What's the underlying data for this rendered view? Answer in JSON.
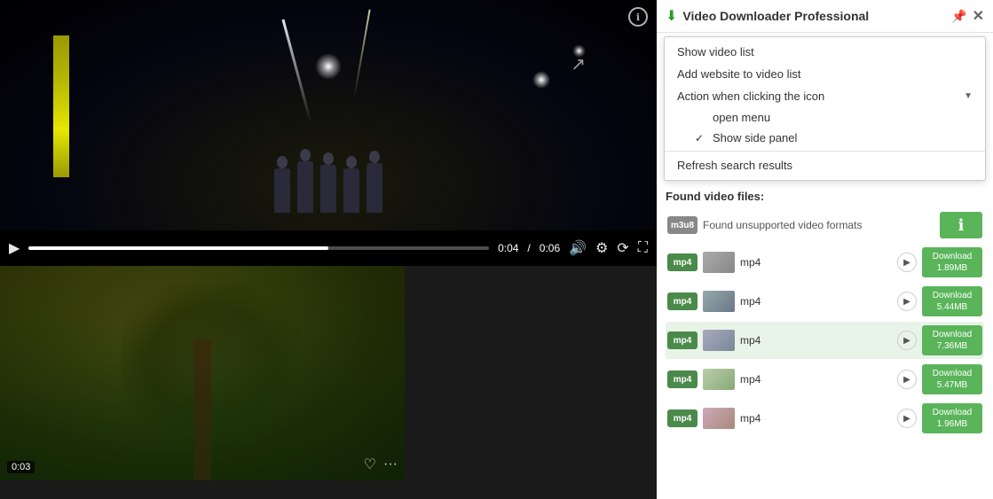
{
  "panel": {
    "title": "Video Downloader Professional",
    "pin_label": "📌",
    "close_label": "✕"
  },
  "menu": {
    "show_video_list": "Show video list",
    "add_website": "Add website to video list",
    "action_label": "Action when clicking the icon",
    "open_menu": "open menu",
    "show_side_panel": "Show side panel",
    "refresh": "Refresh search results"
  },
  "found_section": {
    "header": "Found video files:"
  },
  "video_rows": [
    {
      "format": "m3u8",
      "badge_class": "badge-m3u8",
      "label": "Found unsupported video formats",
      "type": "unsupported"
    },
    {
      "format": "mp4",
      "badge_class": "badge-mp4",
      "label": "mp4",
      "size": "Download\n1.89MB",
      "type": "normal",
      "thumb_class": "thumb-preview-1"
    },
    {
      "format": "mp4",
      "badge_class": "badge-mp4",
      "label": "mp4",
      "size": "Download\n5.44MB",
      "type": "normal",
      "thumb_class": "thumb-preview-2"
    },
    {
      "format": "mp4",
      "badge_class": "badge-mp4",
      "label": "mp4",
      "size": "Download\n7.36MB",
      "type": "normal",
      "highlighted": true,
      "thumb_class": "thumb-preview-3"
    },
    {
      "format": "mp4",
      "badge_class": "badge-mp4",
      "label": "mp4",
      "size": "Download\n5.47MB",
      "type": "normal",
      "thumb_class": "thumb-preview-4"
    },
    {
      "format": "mp4",
      "badge_class": "badge-mp4",
      "label": "mp4",
      "size": "Download\n1.96MB",
      "type": "normal",
      "thumb_class": "thumb-preview-5"
    }
  ],
  "video_player": {
    "current_time": "0:04",
    "total_time": "0:06",
    "progress_pct": 65
  },
  "thumb1": {
    "timer": "0:03"
  },
  "colors": {
    "green": "#5ab45a",
    "dark_green": "#2a9a2a"
  }
}
